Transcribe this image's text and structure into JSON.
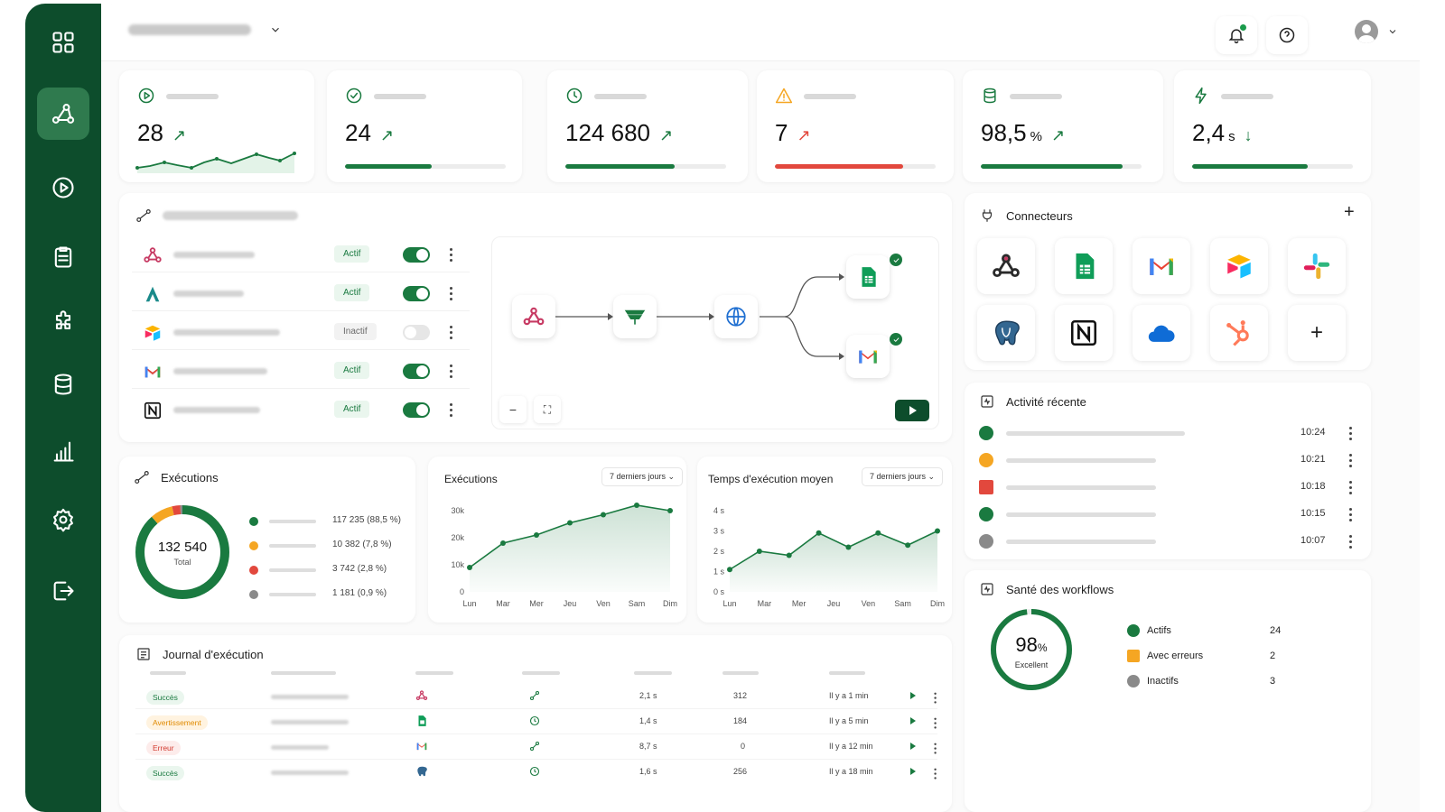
{
  "colors": {
    "primary": "#0d4d2c",
    "success": "#1a7a40",
    "warning": "#f5a623",
    "error": "#e2483d",
    "neutral": "#8a8a8a"
  },
  "sidebar": {
    "items": [
      {
        "icon": "grid-icon"
      },
      {
        "icon": "workflow-icon",
        "active": true
      },
      {
        "icon": "play-icon"
      },
      {
        "icon": "clipboard-icon"
      },
      {
        "icon": "puzzle-icon"
      },
      {
        "icon": "database-icon"
      },
      {
        "icon": "bar-chart-icon"
      },
      {
        "icon": "settings-icon"
      },
      {
        "icon": "logout-icon"
      }
    ]
  },
  "kpis": [
    {
      "icon": "play-circle-icon",
      "value": "28",
      "trend": "↗",
      "trend_color": "#1a7a40"
    },
    {
      "icon": "check-circle-icon",
      "value": "24",
      "trend": "↗",
      "trend_color": "#1a7a40",
      "progress": 0.54
    },
    {
      "icon": "clock-icon",
      "value": "124 680",
      "trend": "↗",
      "trend_color": "#1a7a40",
      "progress": 0.68
    },
    {
      "icon": "warning-icon",
      "value": "7",
      "trend": "↗",
      "trend_color": "#e2483d",
      "progress": 0.8
    },
    {
      "icon": "database-icon",
      "value": "98,5",
      "unit": "%",
      "trend": "↗",
      "trend_color": "#1a7a40",
      "progress": 0.88
    },
    {
      "icon": "bolt-icon",
      "value": "2,4",
      "unit": "s",
      "trend": "↓",
      "trend_color": "#1a7a40",
      "progress": 0.72
    }
  ],
  "workflows": {
    "rows": [
      {
        "logo": "webhook-icon",
        "status": "Actif",
        "enabled": true
      },
      {
        "logo": "a-logo-icon",
        "status": "Actif",
        "enabled": true
      },
      {
        "logo": "airtable-icon",
        "status": "Inactif",
        "enabled": false
      },
      {
        "logo": "gmail-icon",
        "status": "Actif",
        "enabled": true
      },
      {
        "logo": "notion-icon",
        "status": "Actif",
        "enabled": true
      }
    ],
    "canvas_controls": {
      "zoom_out": "−",
      "fit": "⛶"
    }
  },
  "connectors": {
    "title": "Connecteurs",
    "add": "+",
    "items": [
      "webhook-icon",
      "google-sheets-icon",
      "gmail-icon",
      "airtable-icon",
      "slack-icon",
      "postgresql-icon",
      "notion-icon",
      "cloud-icon",
      "hubspot-icon",
      "add-icon"
    ],
    "add_tile": "+"
  },
  "activity": {
    "title": "Activité récente",
    "rows": [
      {
        "status": "success",
        "time": "10:24"
      },
      {
        "status": "pending",
        "time": "10:21"
      },
      {
        "status": "error",
        "time": "10:18"
      },
      {
        "status": "success",
        "time": "10:15"
      },
      {
        "status": "neutral",
        "time": "10:07"
      }
    ]
  },
  "executions": {
    "title": "Exécutions",
    "total": "132 540",
    "total_label": "Total",
    "legend": [
      {
        "color": "#1a7a40",
        "value": "117 235  (88,5 %)"
      },
      {
        "color": "#f5a623",
        "value": "10 382  (7,8 %)"
      },
      {
        "color": "#e2483d",
        "value": "3 742  (2,8 %)"
      },
      {
        "color": "#8a8a8a",
        "value": "1 181  (0,9 %)"
      }
    ]
  },
  "charts": {
    "exec_title": "Exécutions",
    "avg_title": "Temps d'exécution moyen",
    "range_label": "7 derniers jours ⌄"
  },
  "chart_data": [
    {
      "type": "line",
      "title": "Exécutions",
      "categories": [
        "Lun",
        "Mar",
        "Mer",
        "Jeu",
        "Ven",
        "Sam",
        "Dim"
      ],
      "values": [
        9000,
        18000,
        21000,
        25500,
        28500,
        32000,
        30000
      ],
      "yticks": [
        "0",
        "10k",
        "20k",
        "30k"
      ],
      "ylim": [
        0,
        30000
      ]
    },
    {
      "type": "line",
      "title": "Temps d'exécution moyen",
      "categories": [
        "Lun",
        "Mar",
        "Mer",
        "Jeu",
        "Ven",
        "Sam",
        "Dim"
      ],
      "values": [
        1.1,
        2.0,
        1.8,
        2.9,
        2.2,
        2.9,
        2.3,
        3.0
      ],
      "yticks": [
        "0 s",
        "1 s",
        "2 s",
        "3 s",
        "4 s"
      ],
      "ylim": [
        0,
        4
      ]
    }
  ],
  "log": {
    "title": "Journal d'exécution",
    "rows": [
      {
        "tag": "Succès",
        "tag_kind": "ok",
        "app": "webhook-icon",
        "trigger": "link-icon",
        "duration": "2,1 s",
        "count": "312",
        "when": "Il y a 1 min"
      },
      {
        "tag": "Avertissement",
        "tag_kind": "warn",
        "app": "google-sheets-icon",
        "trigger": "clock-icon",
        "duration": "1,4 s",
        "count": "184",
        "when": "Il y a 5 min"
      },
      {
        "tag": "Erreur",
        "tag_kind": "err",
        "app": "gmail-icon",
        "trigger": "link-icon",
        "duration": "8,7 s",
        "count": "0",
        "when": "Il y a 12 min"
      },
      {
        "tag": "Succès",
        "tag_kind": "ok",
        "app": "postgresql-icon",
        "trigger": "clock-icon",
        "duration": "1,6 s",
        "count": "256",
        "when": "Il y a 18 min"
      }
    ]
  },
  "health": {
    "title": "Santé des workflows",
    "score": "98",
    "score_unit": "%",
    "score_label": "Excellent",
    "rows": [
      {
        "label": "Actifs",
        "count": "24",
        "color": "#1a7a40"
      },
      {
        "label": "Avec erreurs",
        "count": "2",
        "color": "#f5a623"
      },
      {
        "label": "Inactifs",
        "count": "3",
        "color": "#8a8a8a"
      }
    ]
  }
}
